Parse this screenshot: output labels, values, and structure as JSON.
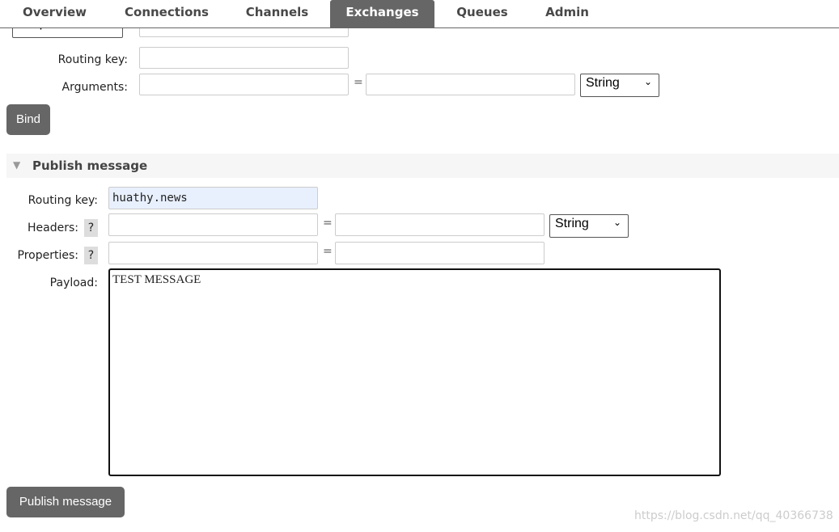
{
  "tabs": [
    {
      "label": "Overview"
    },
    {
      "label": "Connections"
    },
    {
      "label": "Channels"
    },
    {
      "label": "Exchanges",
      "active": true
    },
    {
      "label": "Queues"
    },
    {
      "label": "Admin"
    }
  ],
  "bind": {
    "destination_select": "To queue",
    "routing_key_label": "Routing key:",
    "arguments_label": "Arguments:",
    "eq": "=",
    "type_select": "String",
    "button": "Bind"
  },
  "publish": {
    "section_title": "Publish message",
    "routing_key_label": "Routing key:",
    "routing_key_value": "huathy.news",
    "headers_label": "Headers:",
    "properties_label": "Properties:",
    "help": "?",
    "eq": "=",
    "type_select": "String",
    "payload_label": "Payload:",
    "payload_value": "TEST MESSAGE",
    "button": "Publish message"
  },
  "watermark": "https://blog.csdn.net/qq_40366738"
}
